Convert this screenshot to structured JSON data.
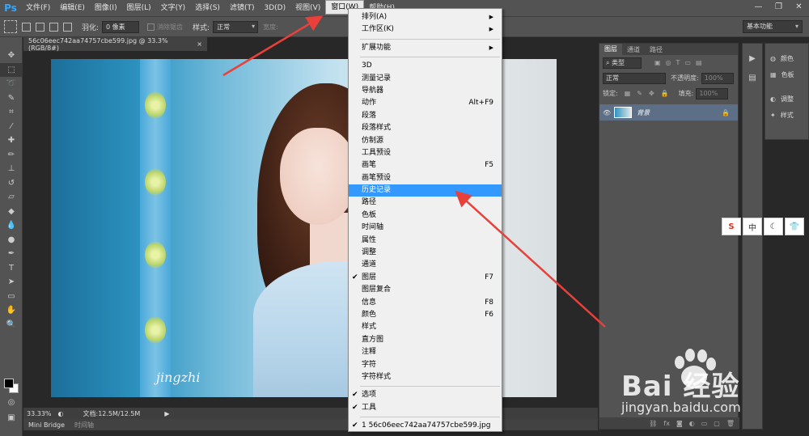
{
  "app": {
    "logo": "Ps"
  },
  "menubar": {
    "items": [
      "文件(F)",
      "编辑(E)",
      "图像(I)",
      "图层(L)",
      "文字(Y)",
      "选择(S)",
      "滤镜(T)",
      "3D(D)",
      "视图(V)",
      "窗口(W)",
      "帮助(H)"
    ],
    "active_index": 9
  },
  "options_bar": {
    "feather_label": "羽化:",
    "feather_value": "0 像素",
    "antialias_label": "消除锯齿",
    "style_label": "样式:",
    "style_value": "正常",
    "width_label": "宽度:",
    "workspace": "基本功能"
  },
  "document": {
    "tab_title": "56c06eec742aa74757cbe599.jpg @ 33.3%(RGB/8#)",
    "zoom": "33.33%",
    "doc_info": "文档:12.5M/12.5M",
    "signature": "jingzhi"
  },
  "bottom_tabs": [
    "Mini Bridge",
    "时间轴"
  ],
  "layers_panel": {
    "tabs": [
      "图层",
      "通道",
      "路径"
    ],
    "kind_label": "类型",
    "blend_mode": "正常",
    "opacity_label": "不透明度:",
    "opacity_value": "100%",
    "lock_label": "锁定:",
    "fill_label": "填充:",
    "fill_value": "100%",
    "layer_name": "背景"
  },
  "side_panels": [
    {
      "icon": "palette-icon",
      "label": "颜色"
    },
    {
      "icon": "swatches-icon",
      "label": "色板"
    },
    {
      "icon": "adjustments-icon",
      "label": "调整"
    },
    {
      "icon": "styles-icon",
      "label": "样式"
    }
  ],
  "ime_bar": [
    "S",
    "中",
    "☾",
    "👕"
  ],
  "window_menu": {
    "groups": [
      [
        {
          "label": "排列(A)",
          "submenu": true
        },
        {
          "label": "工作区(K)",
          "submenu": true
        }
      ],
      [
        {
          "label": "扩展功能",
          "submenu": true
        }
      ],
      [
        {
          "label": "3D"
        },
        {
          "label": "测量记录"
        },
        {
          "label": "导航器"
        },
        {
          "label": "动作",
          "shortcut": "Alt+F9"
        },
        {
          "label": "段落"
        },
        {
          "label": "段落样式"
        },
        {
          "label": "仿制源"
        },
        {
          "label": "工具预设"
        },
        {
          "label": "画笔",
          "shortcut": "F5"
        },
        {
          "label": "画笔预设"
        },
        {
          "label": "历史记录",
          "highlighted": true
        },
        {
          "label": "路径"
        },
        {
          "label": "色板"
        },
        {
          "label": "时间轴"
        },
        {
          "label": "属性"
        },
        {
          "label": "调整"
        },
        {
          "label": "通道"
        },
        {
          "label": "图层",
          "shortcut": "F7",
          "checked": true
        },
        {
          "label": "图层复合"
        },
        {
          "label": "信息",
          "shortcut": "F8"
        },
        {
          "label": "颜色",
          "shortcut": "F6"
        },
        {
          "label": "样式"
        },
        {
          "label": "直方图"
        },
        {
          "label": "注释"
        },
        {
          "label": "字符"
        },
        {
          "label": "字符样式"
        }
      ],
      [
        {
          "label": "选项",
          "checked": true
        },
        {
          "label": "工具",
          "checked": true
        }
      ],
      [
        {
          "label": "1 56c06eec742aa74757cbe599.jpg",
          "checked": true
        }
      ]
    ]
  },
  "watermark": {
    "brand": "Bai 经验",
    "url": "jingyan.baidu.com"
  },
  "colors": {
    "accent": "#3399ff",
    "arrow": "#e8403a",
    "ui_bg": "#535353"
  }
}
